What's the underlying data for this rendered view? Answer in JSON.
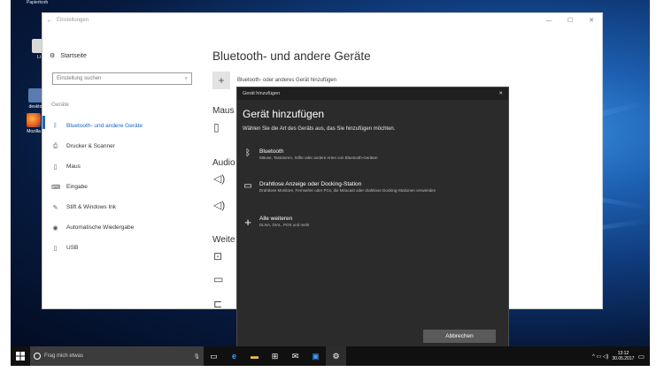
{
  "desktop": {
    "top_label": "Papierkorb",
    "icons": [
      {
        "label": "Li",
        "icon": "app-icon"
      },
      {
        "label": "deskto",
        "icon": "app-icon"
      },
      {
        "label": "Mozilla",
        "icon": "firefox-icon"
      }
    ]
  },
  "settings": {
    "window_title": "Einstellungen",
    "controls": {
      "minimize": "—",
      "maximize": "☐",
      "close": "✕"
    },
    "home_label": "Startseite",
    "search_placeholder": "Einstellung suchen",
    "section_label": "Geräte",
    "nav": [
      {
        "label": "Bluetooth- und andere Geräte",
        "icon": "bluetooth-icon",
        "active": true
      },
      {
        "label": "Drucker & Scanner",
        "icon": "printer-icon",
        "active": false
      },
      {
        "label": "Maus",
        "icon": "mouse-icon",
        "active": false
      },
      {
        "label": "Eingabe",
        "icon": "keyboard-icon",
        "active": false
      },
      {
        "label": "Stift & Windows Ink",
        "icon": "pen-icon",
        "active": false
      },
      {
        "label": "Automatische Wiedergabe",
        "icon": "autoplay-icon",
        "active": false
      },
      {
        "label": "USB",
        "icon": "usb-icon",
        "active": false
      }
    ],
    "page_title": "Bluetooth- und andere Geräte",
    "add_device_label": "Bluetooth- oder anderes Gerät hinzufügen",
    "section_mouse": "Maus",
    "section_audio": "Audio",
    "section_other": "Weite"
  },
  "dialog": {
    "titlebar": "Gerät hinzufügen",
    "close": "✕",
    "title": "Gerät hinzufügen",
    "description": "Wählen Sie die Art des Geräts aus, das Sie hinzufügen möchten.",
    "options": [
      {
        "name": "Bluetooth",
        "desc": "Mäuse, Tastaturen, Stifte oder andere Arten von Bluetooth-Geräten",
        "icon": "bluetooth-icon"
      },
      {
        "name": "Drahtlose Anzeige oder Docking-Station",
        "desc": "Drahtlose Monitore, Fernseher oder PCs, die Miracast oder drahtlose Docking-Stationen verwenden",
        "icon": "monitor-icon"
      },
      {
        "name": "Alle weiteren",
        "desc": "DLNA, DIAL, POS und mehr",
        "icon": "plus-icon"
      }
    ],
    "cancel_label": "Abbrechen"
  },
  "taskbar": {
    "search_placeholder": "Frag mich etwas",
    "apps": [
      "task-view-icon",
      "edge-icon",
      "file-explorer-icon",
      "store-icon",
      "mail-icon",
      "app-icon",
      "settings-icon"
    ],
    "tray": "^ ▭ ◁)",
    "time": "13:12",
    "date": "30.05.2017"
  }
}
